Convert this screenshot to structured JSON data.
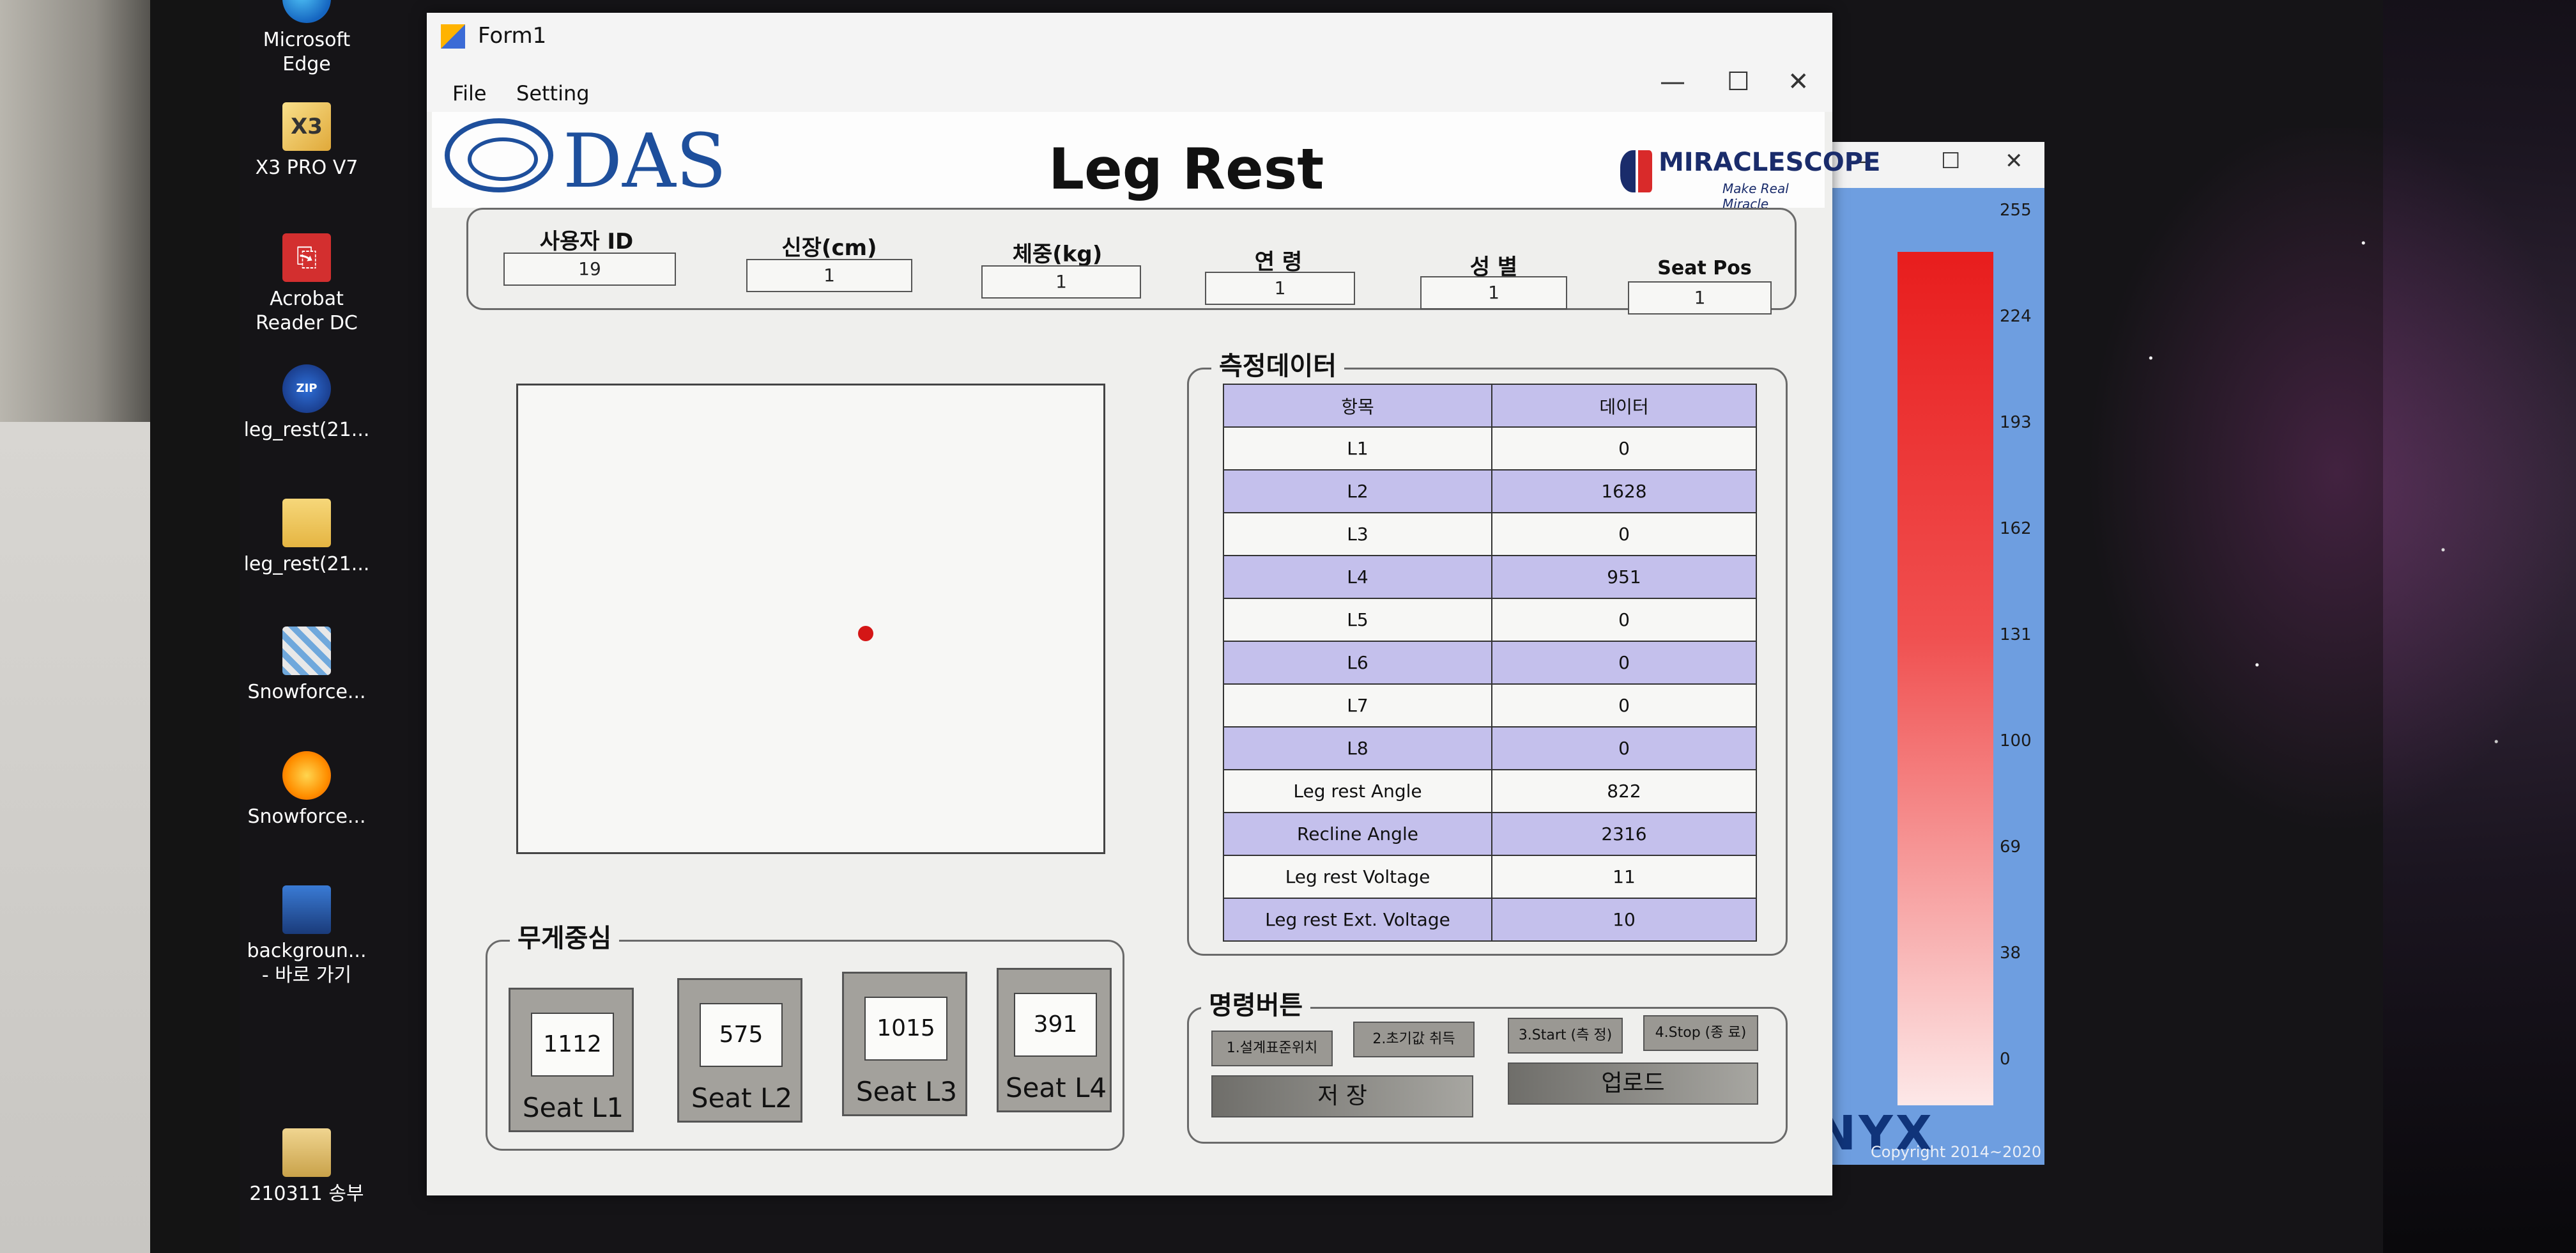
{
  "desktop": {
    "icons": [
      {
        "label": "Microsoft Edge",
        "icon": "edge-icon"
      },
      {
        "label": "X3 PRO V7",
        "icon": "x3-icon"
      },
      {
        "label": "Acrobat Reader DC",
        "icon": "pdf-icon"
      },
      {
        "label": "leg_rest(21...",
        "icon": "zip-icon"
      },
      {
        "label": "leg_rest(21...",
        "icon": "folder-icon"
      },
      {
        "label": "Snowforce...",
        "icon": "snowforce-icon"
      },
      {
        "label": "Snowforce...",
        "icon": "snowforce-icon"
      },
      {
        "label": "backgroun... - 바로 가기",
        "icon": "shortcut-icon"
      },
      {
        "label": "210311 송부",
        "icon": "file-icon"
      }
    ]
  },
  "form": {
    "title": "Form1",
    "menu": [
      "File",
      "Setting"
    ],
    "header": {
      "logo_text": "DAS",
      "title": "Leg Rest",
      "brand": "MIRACLESCOPE",
      "brand_tagline": "Make Real Miracle"
    },
    "user_fields": [
      {
        "label": "사용자 ID",
        "value": "19"
      },
      {
        "label": "신장(cm)",
        "value": "1"
      },
      {
        "label": "체중(kg)",
        "value": "1"
      },
      {
        "label": "연 령",
        "value": "1"
      },
      {
        "label": "성 별",
        "value": "1"
      },
      {
        "label": "Seat Pos",
        "value": "1"
      }
    ],
    "measure": {
      "title": "측정데이터",
      "headers": [
        "항목",
        "데이터"
      ],
      "rows": [
        [
          "L1",
          "0"
        ],
        [
          "L2",
          "1628"
        ],
        [
          "L3",
          "0"
        ],
        [
          "L4",
          "951"
        ],
        [
          "L5",
          "0"
        ],
        [
          "L6",
          "0"
        ],
        [
          "L7",
          "0"
        ],
        [
          "L8",
          "0"
        ],
        [
          "Leg rest Angle",
          "822"
        ],
        [
          "Recline Angle",
          "2316"
        ],
        [
          "Leg rest Voltage",
          "11"
        ],
        [
          "Leg rest Ext. Voltage",
          "10"
        ]
      ]
    },
    "cog": {
      "title": "무게중심",
      "seats": [
        {
          "label": "Seat L1",
          "value": "1112"
        },
        {
          "label": "Seat L2",
          "value": "575"
        },
        {
          "label": "Seat L3",
          "value": "1015"
        },
        {
          "label": "Seat L4",
          "value": "391"
        }
      ]
    },
    "commands": {
      "title": "명령버튼",
      "buttons": [
        "1.설계표준위치",
        "2.초기값 취득",
        "3.Start (측 정)",
        "4.Stop (종 료)"
      ],
      "save": "저 장",
      "upload": "업로드"
    }
  },
  "kitronyx": {
    "scale_labels": [
      "255",
      "224",
      "193",
      "162",
      "131",
      "100",
      "69",
      "38",
      "0"
    ],
    "logo": "KITRONYX",
    "copyright": "Copyright 2014~2020"
  }
}
